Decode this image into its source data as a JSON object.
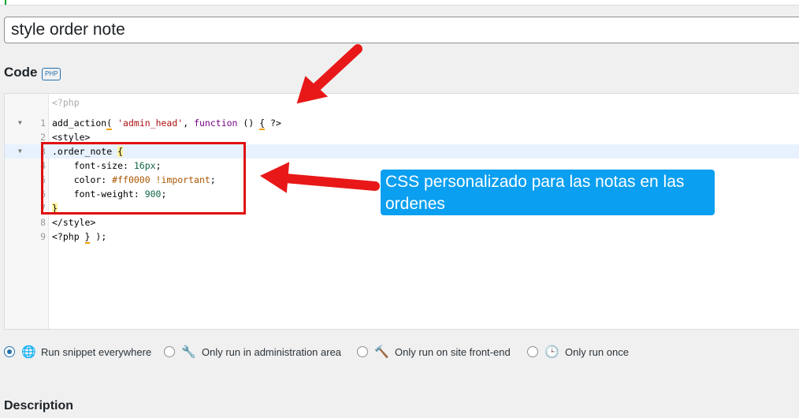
{
  "snippet": {
    "title": "style order note"
  },
  "code_section": {
    "label": "Code",
    "lang_badge": "PHP"
  },
  "editor": {
    "header_line": "<?php",
    "line_numbers": [
      "1",
      "2",
      "3",
      "4",
      "5",
      "6",
      "7",
      "8",
      "9"
    ]
  },
  "callout": {
    "text": "CSS personalizado para las notas en las ordenes"
  },
  "scope_options": [
    {
      "label": "Run snippet everywhere",
      "icon": "globe-icon",
      "selected": true
    },
    {
      "label": "Only run in administration area",
      "icon": "wrench-icon",
      "selected": false
    },
    {
      "label": "Only run on site front-end",
      "icon": "hammer-icon",
      "selected": false
    },
    {
      "label": "Only run once",
      "icon": "clock-icon",
      "selected": false
    }
  ],
  "description": {
    "label": "Description"
  },
  "colors": {
    "accent": "#2271b1",
    "annotation_red": "#e01010",
    "callout_blue": "#0a9ff0"
  }
}
